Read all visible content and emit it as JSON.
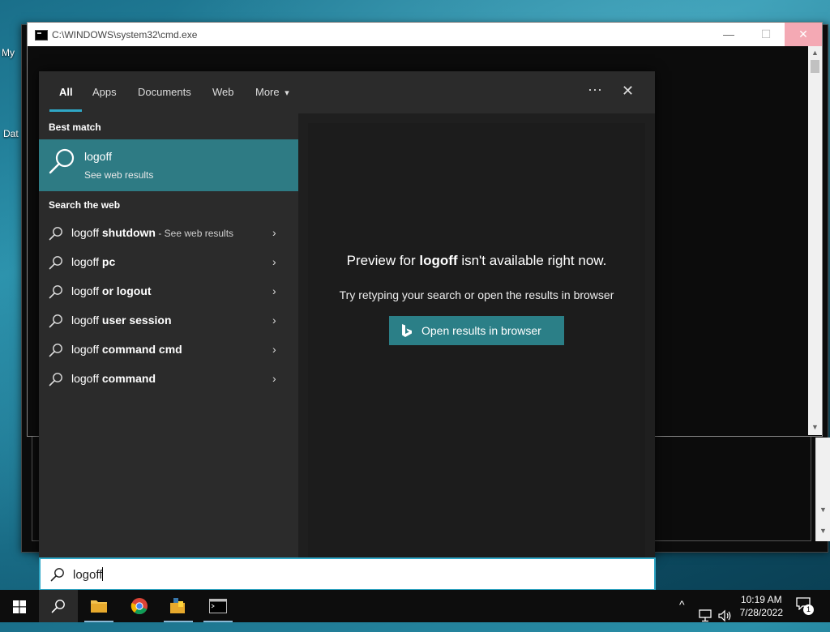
{
  "desktop": {
    "icon_label_1": "My",
    "icon_label_2": "Dat"
  },
  "cmd_window": {
    "title": "C:\\WINDOWS\\system32\\cmd.exe",
    "minimize": "—",
    "maximize": "☐",
    "close": "✕"
  },
  "search": {
    "tabs": [
      "All",
      "Apps",
      "Documents",
      "Web",
      "More"
    ],
    "more_arrow": "▾",
    "more_options": "···",
    "close": "✕",
    "best_match_heading": "Best match",
    "best_match": {
      "title": "logoff",
      "subtitle": "See web results"
    },
    "search_web_heading": "Search the web",
    "web_results": [
      {
        "prefix": "logoff ",
        "bold": "shutdown",
        "suffix": " - See web results"
      },
      {
        "prefix": "logoff ",
        "bold": "pc",
        "suffix": ""
      },
      {
        "prefix": "logoff ",
        "bold": "or logout",
        "suffix": ""
      },
      {
        "prefix": "logoff ",
        "bold": "user session",
        "suffix": ""
      },
      {
        "prefix": "logoff ",
        "bold": "command cmd",
        "suffix": ""
      },
      {
        "prefix": "logoff ",
        "bold": "command",
        "suffix": ""
      }
    ],
    "chevron": "›",
    "preview": {
      "title_prefix": "Preview for ",
      "title_bold": "logoff",
      "title_suffix": " isn't available right now.",
      "subtitle": "Try retyping your search or open the results in browser",
      "button": "Open results in browser"
    },
    "query": "logoff"
  },
  "taskbar": {
    "time": "10:19 AM",
    "date": "7/28/2022",
    "notification_count": "1",
    "tray_chevron": "^"
  },
  "colors": {
    "accent": "#2e7b84",
    "focus": "#2fa7c6",
    "panel": "#2b2b2b"
  }
}
